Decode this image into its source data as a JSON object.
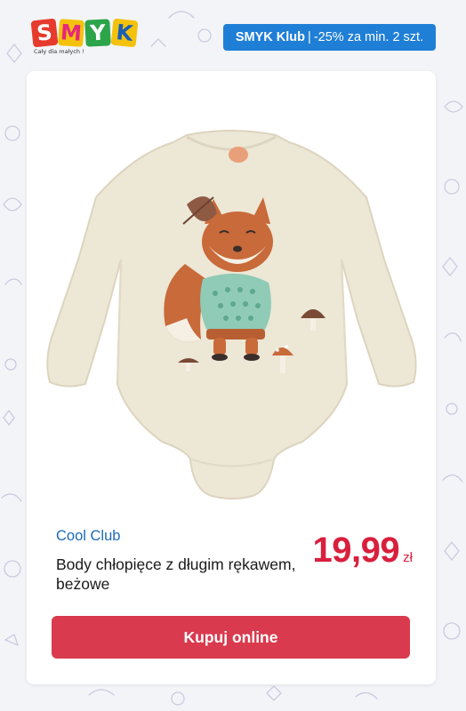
{
  "logo": {
    "letters": [
      "S",
      "M",
      "Y",
      "K"
    ],
    "tagline": "Cały dla małych !"
  },
  "club_badge": {
    "name": "SMYK Klub",
    "separator": "|",
    "offer": "-25% za min. 2 szt."
  },
  "product": {
    "image_icon": "fox-bodysuit-image",
    "brand": "Cool Club",
    "name": "Body chłopięce z długim rękawem, beżowe",
    "price": "19,99",
    "currency": "zł"
  },
  "cta": {
    "label": "Kupuj online"
  },
  "colors": {
    "background": "#f3f4f8",
    "badge": "#1f7fd6",
    "brand_text": "#1c6ab7",
    "price": "#d91f3d",
    "button": "#d93a4e"
  }
}
